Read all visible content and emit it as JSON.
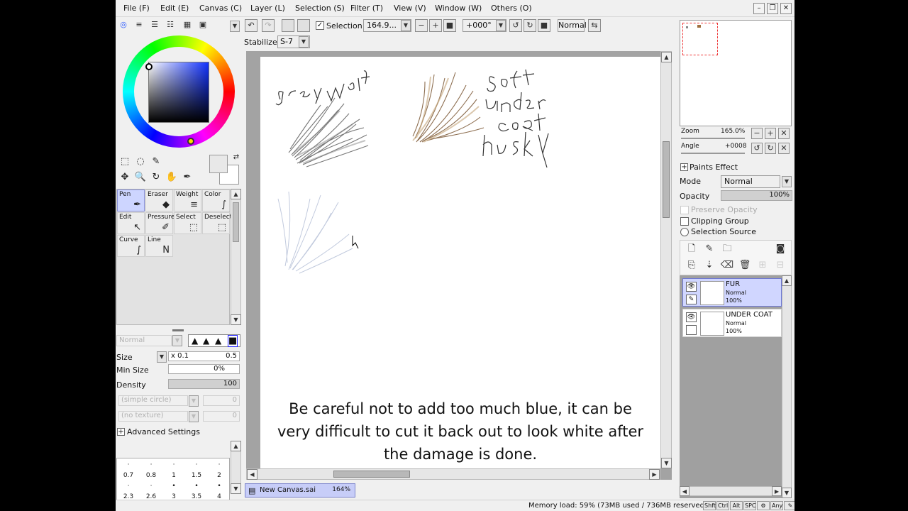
{
  "menu": [
    "File (F)",
    "Edit (E)",
    "Canvas (C)",
    "Layer (L)",
    "Selection (S)",
    "Filter (T)",
    "View (V)",
    "Window (W)",
    "Others (O)"
  ],
  "window_controls": {
    "minimize": "–",
    "restore": "❐",
    "close": "✕"
  },
  "toolbar": {
    "undo_icon": "↶",
    "redo_icon": "↷",
    "selection_checked": "✓",
    "selection_label": "Selection",
    "zoom_value": "164.9...",
    "zoom_out": "−",
    "zoom_in": "+",
    "zoom_reset": "■",
    "angle_value": "+000°",
    "rotate_ccw": "↺",
    "rotate_cw": "↻",
    "rotate_reset": "■",
    "blend_mode": "Normal",
    "flip_icon": "⇆",
    "dropdown_arrow": "▼",
    "stabilizer_label": "Stabilizer",
    "stabilizer_value": "S-7"
  },
  "color_panel": {
    "tab_icons": [
      "◎",
      "≡",
      "☰",
      "☷",
      "▦",
      "▣"
    ],
    "collapse_icon": "▼"
  },
  "selection_tools": [
    "⬚",
    "◌",
    "✎",
    "",
    "✥",
    "🔍",
    "↻",
    "✋",
    "✒"
  ],
  "swap_icon": "⇄",
  "tools": [
    {
      "label": "Pen",
      "icon": "✒",
      "selected": true
    },
    {
      "label": "Eraser",
      "icon": "◆",
      "selected": false
    },
    {
      "label": "Weight",
      "icon": "≡",
      "selected": false
    },
    {
      "label": "Color",
      "icon": "∫",
      "selected": false
    },
    {
      "label": "Edit",
      "icon": "↖",
      "selected": false
    },
    {
      "label": "Pressure",
      "icon": "✐",
      "selected": false
    },
    {
      "label": "Select",
      "icon": "⬚",
      "selected": false
    },
    {
      "label": "Deselect",
      "icon": "⬚",
      "selected": false
    },
    {
      "label": "Curve",
      "icon": "∫",
      "selected": false
    },
    {
      "label": "Line",
      "icon": "N",
      "selected": false
    }
  ],
  "scroll": {
    "up": "▲",
    "down": "▼",
    "left": "◀",
    "right": "▶"
  },
  "brush": {
    "blend_mode": "Normal",
    "shapes": [
      "▲",
      "▲",
      "▲",
      "■"
    ],
    "size_label": "Size",
    "size_multiplier": "x 0.1",
    "size_value": "0.5",
    "min_size_label": "Min Size",
    "min_size_value": "0%",
    "density_label": "Density",
    "density_value": "100",
    "shape_select": "(simple circle)",
    "shape_value": "0",
    "texture_select": "(no texture)",
    "texture_value": "0",
    "advanced_label": "Advanced Settings",
    "advanced_icon": "+",
    "presets": [
      [
        "·",
        "·",
        "·",
        "·",
        "·"
      ],
      [
        "0.7",
        "0.8",
        "1",
        "1.5",
        "2"
      ],
      [
        "·",
        "·",
        "•",
        "•",
        "•"
      ],
      [
        "2.3",
        "2.6",
        "3",
        "3.5",
        "4"
      ],
      [
        "•",
        "•",
        "●",
        "●",
        "●"
      ]
    ]
  },
  "canvas": {
    "note_lines": [
      "Be careful not to add too much blue, it can be",
      "very difficult to cut it back out to look white after",
      "the damage is done."
    ],
    "sketch_labels": {
      "grey_wolf": "grey wolf",
      "soft": "Soft",
      "under": "under",
      "coat": "Coat",
      "husky": "husky"
    }
  },
  "canvas_tab": {
    "name": "New Canvas.sai",
    "zoom": "164%",
    "icon": "▤"
  },
  "navigator": {
    "zoom_label": "Zoom",
    "zoom_value": "165.0%",
    "angle_label": "Angle",
    "angle_value": "+0008",
    "zoom_buttons": [
      "−",
      "+",
      "✕"
    ],
    "angle_buttons": [
      "↺",
      "↻",
      "✕"
    ]
  },
  "layer_props": {
    "paints_effect_label": "Paints Effect",
    "expand_icon": "+",
    "mode_label": "Mode",
    "mode_value": "Normal",
    "opacity_label": "Opacity",
    "opacity_value": "100%",
    "preserve_opacity": "Preserve Opacity",
    "clipping_group": "Clipping Group",
    "selection_source": "Selection Source"
  },
  "layer_tools": [
    "🗋",
    "✎",
    "🗀",
    "◙",
    "⎘",
    "⇣",
    "⌫",
    "🗑",
    "⊞",
    "⊟"
  ],
  "layers": [
    {
      "name": "FUR",
      "mode": "Normal",
      "opacity": "100%",
      "active": true,
      "visible_icon": "👁",
      "lock_icon": "✎"
    },
    {
      "name": "UNDER COAT",
      "mode": "Normal",
      "opacity": "100%",
      "active": false,
      "visible_icon": "👁",
      "lock_icon": ""
    }
  ],
  "status": {
    "memory": "Memory load: 59% (73MB used / 736MB reserved)",
    "keys": [
      "Shft",
      "Ctrl",
      "Alt",
      "SPC",
      "⚙",
      "Any",
      "✎"
    ]
  },
  "colors": {
    "active_tool": "#cdd5ff",
    "active_layer": "#d0d6ff",
    "canvas_bg": "#a3a3a3"
  }
}
